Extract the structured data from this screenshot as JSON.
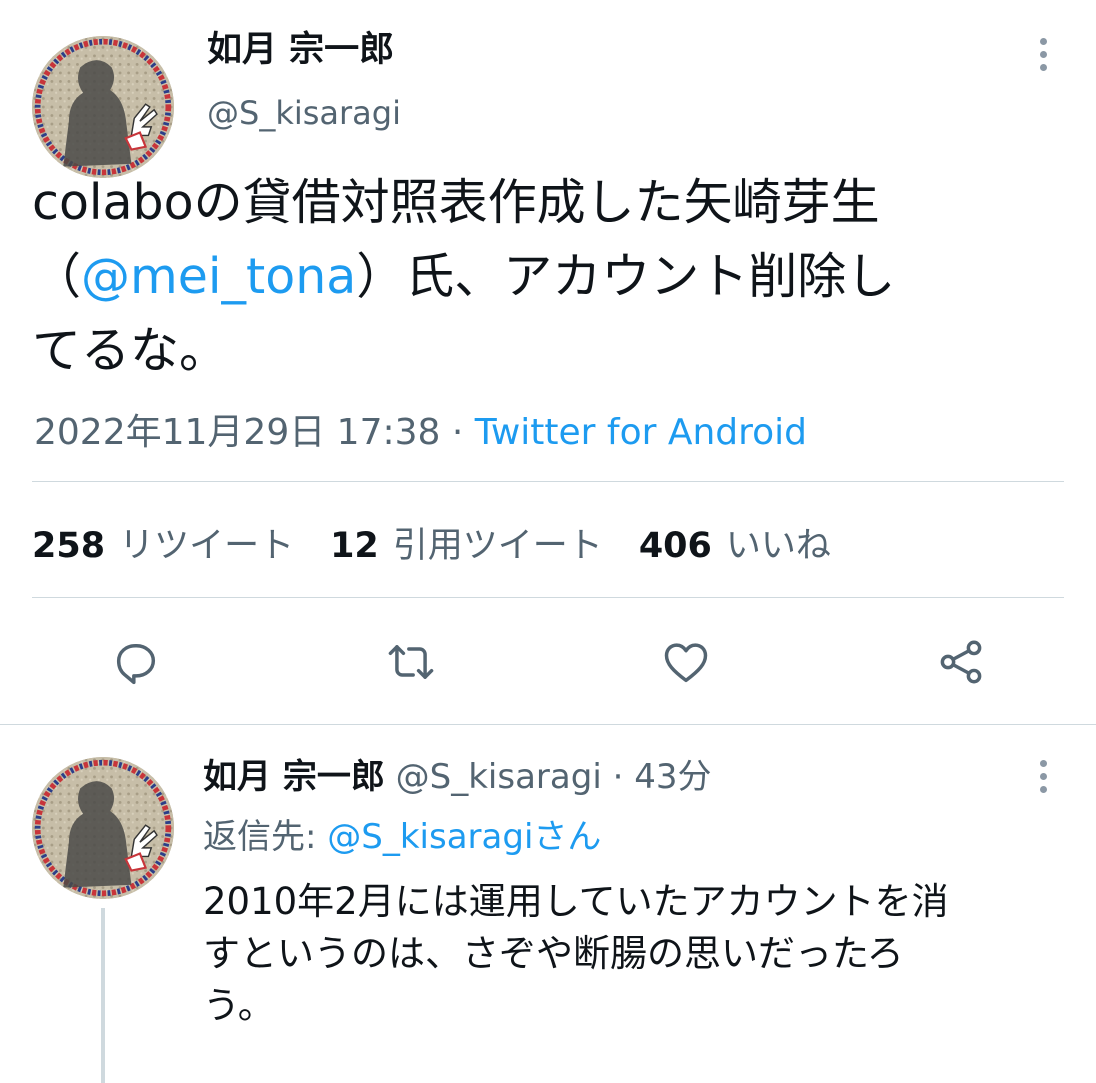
{
  "tweet": {
    "author": {
      "display_name": "如月 宗一郎",
      "handle": "@S_kisaragi"
    },
    "text_lines": [
      [
        "colaboの貸借対照表作成した矢崎芽生"
      ],
      [
        "（",
        "@mei_tona",
        "）氏、アカウント削除し"
      ],
      [
        "てるな。"
      ]
    ],
    "timestamp": "2022年11月29日 17:38",
    "separator": "·",
    "source": "Twitter for Android",
    "stats": [
      {
        "count": "258",
        "label": "リツイート"
      },
      {
        "count": "12",
        "label": "引用ツイート"
      },
      {
        "count": "406",
        "label": "いいね"
      }
    ],
    "actions": [
      {
        "name": "reply",
        "icon": "reply-icon"
      },
      {
        "name": "retweet",
        "icon": "retweet-icon"
      },
      {
        "name": "like",
        "icon": "heart-icon"
      },
      {
        "name": "share",
        "icon": "share-icon"
      }
    ]
  },
  "reply": {
    "author": {
      "display_name": "如月 宗一郎",
      "handle": "@S_kisaragi"
    },
    "separator": "·",
    "time_ago": "43分",
    "replying_to_label": "返信先:",
    "replying_to_handle": "@S_kisaragiさん",
    "text_lines": [
      "2010年2月には運用していたアカウントを消",
      "すというのは、さぞや断腸の思いだったろ",
      "う。"
    ]
  },
  "colors": {
    "text": "#0f1419",
    "secondary": "#536471",
    "accent": "#1d9bf0",
    "divider": "#cfd9de"
  }
}
